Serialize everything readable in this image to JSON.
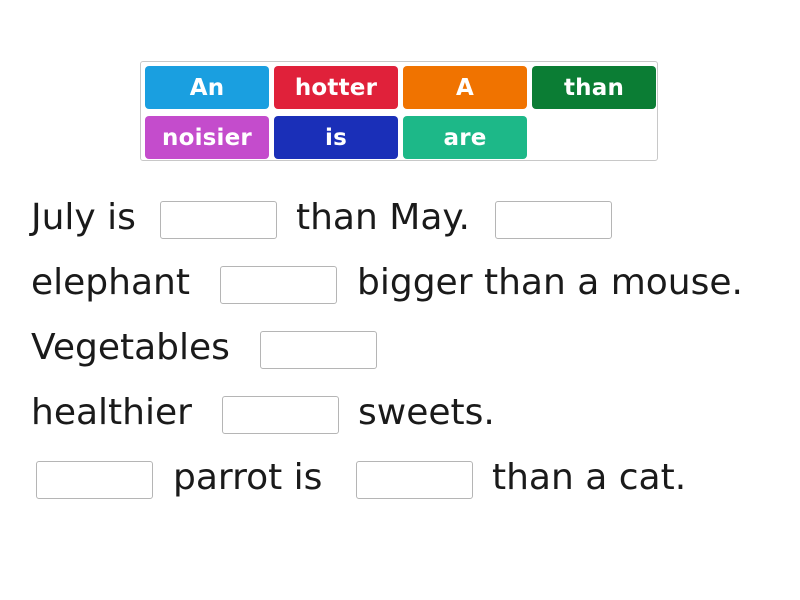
{
  "tile_bank": {
    "tiles": [
      {
        "label": "An",
        "color": "#1a9fe0"
      },
      {
        "label": "hotter",
        "color": "#e0213a"
      },
      {
        "label": "A",
        "color": "#f07300"
      },
      {
        "label": "than",
        "color": "#0b7d34"
      },
      {
        "label": "noisier",
        "color": "#c44ccc"
      },
      {
        "label": "is",
        "color": "#1a2fb8"
      },
      {
        "label": "are",
        "color": "#1db888"
      }
    ]
  },
  "sentences": {
    "line1": {
      "part1": "July is",
      "part2": "than May."
    },
    "line2": {
      "part1": "elephant",
      "part2": "bigger than a mouse."
    },
    "line3": {
      "part1": "Vegetables"
    },
    "line4": {
      "part1": "healthier",
      "part2": "sweets."
    },
    "line5": {
      "part1": "parrot is",
      "part2": "than a cat."
    }
  }
}
